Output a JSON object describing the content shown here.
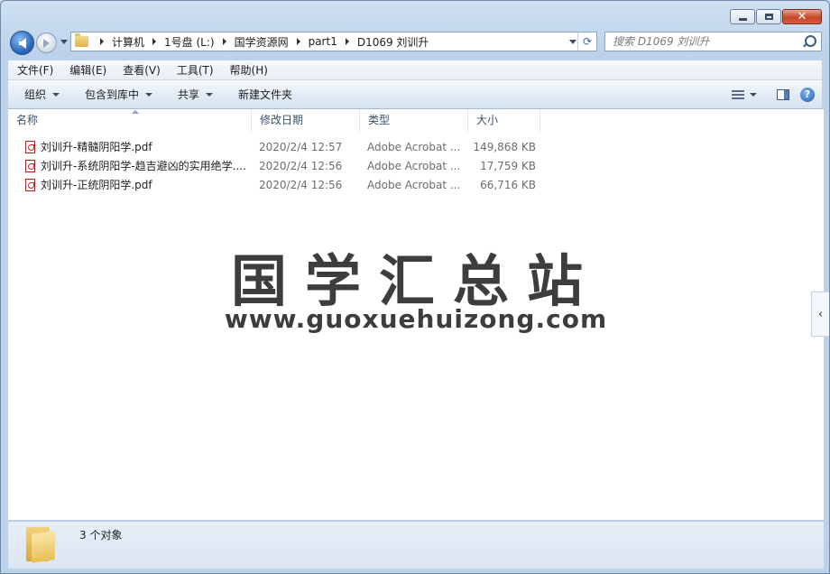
{
  "window": {
    "caption": {
      "minimize": "",
      "maximize": "",
      "close": "✕"
    }
  },
  "address": {
    "crumbs": [
      "计算机",
      "1号盘 (L:)",
      "国学资源网",
      "part1",
      "D1069 刘训升"
    ]
  },
  "search": {
    "placeholder": "搜索 D1069 刘训升"
  },
  "menu": [
    "文件(F)",
    "编辑(E)",
    "查看(V)",
    "工具(T)",
    "帮助(H)"
  ],
  "toolbar": {
    "organize": "组织",
    "include_library": "包含到库中",
    "share": "共享",
    "new_folder": "新建文件夹",
    "help": "?"
  },
  "columns": {
    "name": "名称",
    "date": "修改日期",
    "type": "类型",
    "size": "大小"
  },
  "files": [
    {
      "name": "刘训升-精髓阴阳学.pdf",
      "date": "2020/2/4 12:57",
      "type": "Adobe Acrobat ...",
      "size": "149,868 KB"
    },
    {
      "name": "刘训升-系统阴阳学-趋吉避凶的实用绝学....",
      "date": "2020/2/4 12:56",
      "type": "Adobe Acrobat ...",
      "size": "17,759 KB"
    },
    {
      "name": "刘训升-正统阴阳学.pdf",
      "date": "2020/2/4 12:56",
      "type": "Adobe Acrobat ...",
      "size": "66,716 KB"
    }
  ],
  "watermark": {
    "title": "国学汇总站",
    "url": "www.guoxuehuizong.com"
  },
  "side_toggle": "‹",
  "details": {
    "count_text": "3 个对象"
  },
  "colors": {
    "accent": "#2b6cc2",
    "pdf": "#b81e1e"
  }
}
